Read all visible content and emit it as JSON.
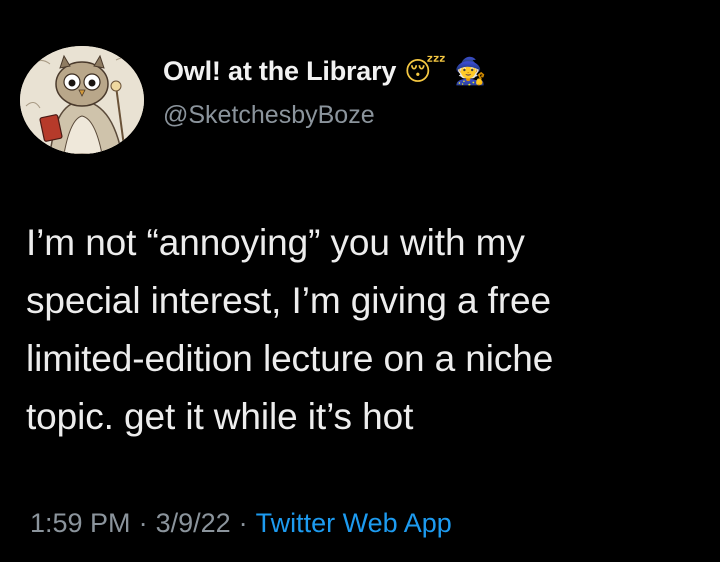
{
  "author": {
    "display_name": "Owl! at the Library",
    "handle": "@SketchesbyBoze",
    "name_emojis": [
      {
        "name": "sleeping-face-icon",
        "glyph": "😴"
      },
      {
        "name": "mage-icon",
        "glyph": "🧙"
      }
    ],
    "avatar_icon": "owl-librarian-avatar"
  },
  "tweet": {
    "lines": [
      "I’m not “annoying” you with my",
      "special interest, I’m giving a free",
      "limited-edition lecture on a niche",
      "topic. get it while it’s hot"
    ]
  },
  "meta": {
    "time": "1:59 PM",
    "separator": "·",
    "date": "3/9/22",
    "source": "Twitter Web App"
  },
  "colors": {
    "background": "#000000",
    "text": "#ededed",
    "secondary": "#8b949c",
    "link": "#1d9bf0"
  }
}
